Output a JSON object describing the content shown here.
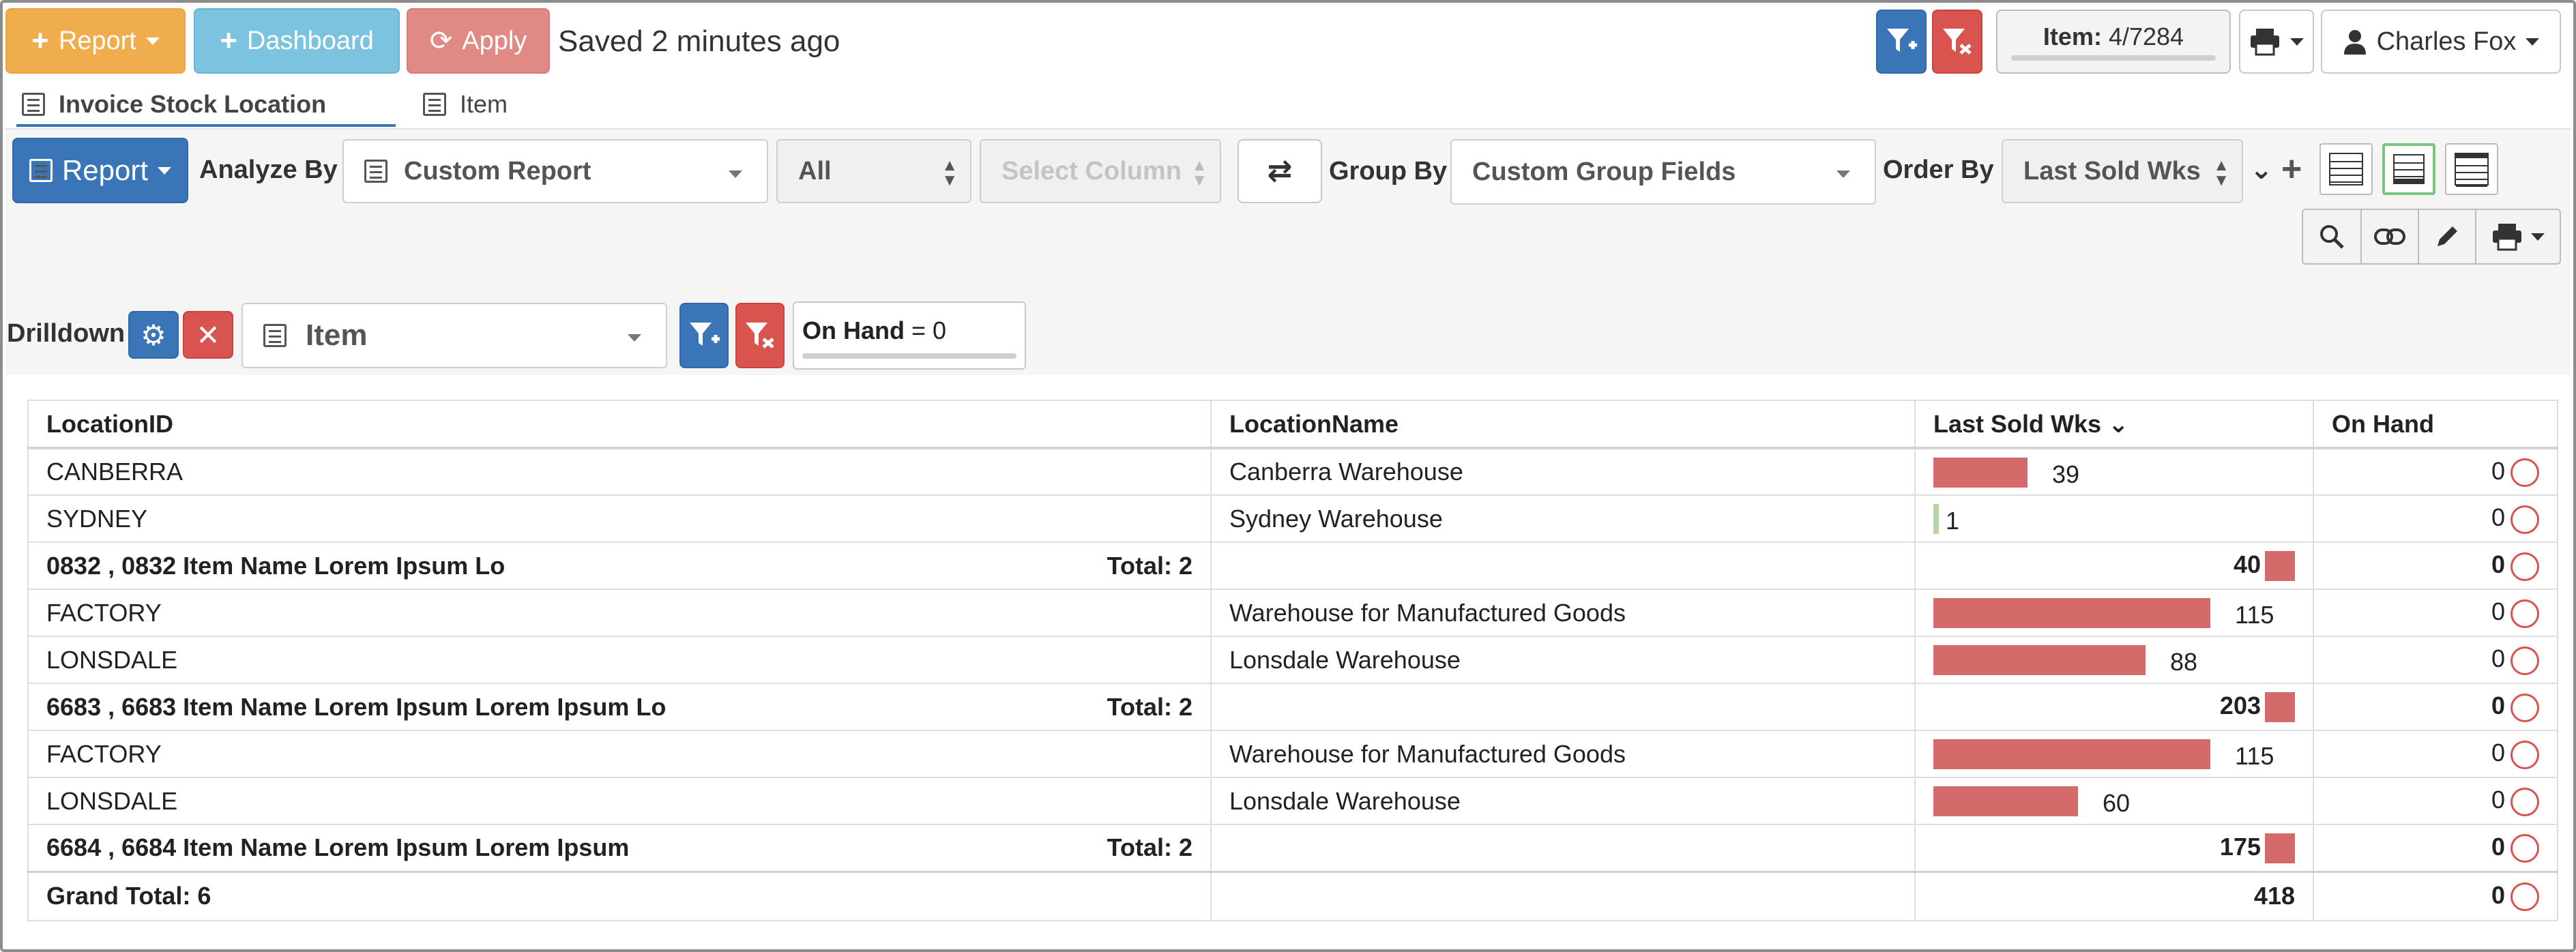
{
  "toolbar": {
    "report_label": "Report",
    "dashboard_label": "Dashboard",
    "apply_label": "Apply",
    "saved_status": "Saved 2 minutes ago",
    "item_counter_label": "Item:",
    "item_counter_value": "4/7284",
    "user_name": "Charles Fox"
  },
  "tabs": [
    {
      "label": "Invoice Stock Location",
      "active": true
    },
    {
      "label": "Item",
      "active": false
    }
  ],
  "analyze": {
    "report_button": "Report",
    "analyze_by_label": "Analyze By",
    "analyze_by_value": "Custom Report",
    "filter_all": "All",
    "select_column_placeholder": "Select Column",
    "group_by_label": "Group By",
    "group_by_value": "Custom Group Fields",
    "order_by_label": "Order By",
    "order_by_value": "Last Sold Wks"
  },
  "drilldown": {
    "label": "Drilldown",
    "select_value": "Item",
    "filter_field": "On Hand",
    "filter_op": " = 0"
  },
  "table": {
    "headers": {
      "location_id": "LocationID",
      "location_name": "LocationName",
      "last_sold": "Last Sold Wks",
      "on_hand": "On Hand"
    },
    "rows": [
      {
        "type": "data",
        "id": "CANBERRA",
        "name": "Canberra Warehouse",
        "last_sold": 39,
        "on_hand": "0"
      },
      {
        "type": "data",
        "id": "SYDNEY",
        "name": "Sydney Warehouse",
        "last_sold": 1,
        "on_hand": "0"
      },
      {
        "type": "total",
        "id": "0832 , 0832 Item Name Lorem Ipsum Lo",
        "count": "Total: 2",
        "last_sold": "40",
        "on_hand": "0"
      },
      {
        "type": "data",
        "id": "FACTORY",
        "name": "Warehouse for Manufactured Goods",
        "last_sold": 115,
        "on_hand": "0"
      },
      {
        "type": "data",
        "id": "LONSDALE",
        "name": "Lonsdale Warehouse",
        "last_sold": 88,
        "on_hand": "0"
      },
      {
        "type": "total",
        "id": "6683 , 6683 Item Name Lorem Ipsum Lorem Ipsum Lo",
        "count": "Total: 2",
        "last_sold": "203",
        "on_hand": "0"
      },
      {
        "type": "data",
        "id": "FACTORY",
        "name": "Warehouse for Manufactured Goods",
        "last_sold": 115,
        "on_hand": "0"
      },
      {
        "type": "data",
        "id": "LONSDALE",
        "name": "Lonsdale Warehouse",
        "last_sold": 60,
        "on_hand": "0"
      },
      {
        "type": "total",
        "id": "6684 , 6684 Item Name Lorem Ipsum Lorem Ipsum",
        "count": "Total: 2",
        "last_sold": "175",
        "on_hand": "0"
      }
    ],
    "grand_total": {
      "label": "Grand Total: 6",
      "last_sold": "418",
      "on_hand": "0"
    }
  },
  "colors": {
    "bar": "#d46a6a",
    "primary": "#3a75b8",
    "danger": "#d9534f",
    "warning": "#f0ad4e"
  }
}
